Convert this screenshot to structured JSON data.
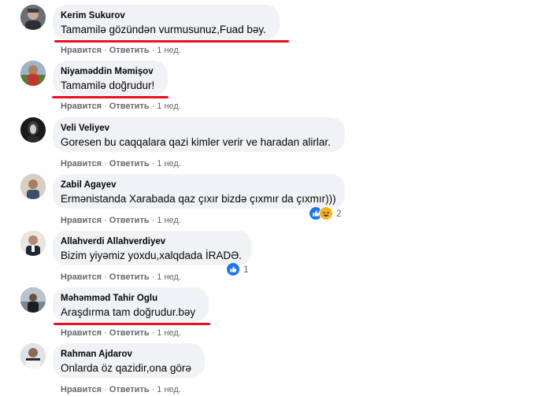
{
  "action_labels": {
    "like": "Нравится",
    "reply": "Ответить",
    "separator": "·"
  },
  "comments": [
    {
      "author": "Kerim Sukurov",
      "text": "Tamamilə gözündən vurmusunuz,Fuad bəy.",
      "time": "1 нед."
    },
    {
      "author": "Niyaməddin Məmişov",
      "text": "Tamamilə doğrudur!",
      "time": "1 нед."
    },
    {
      "author": "Veli Veliyev",
      "text": "Goresen bu caqqalara qazi kimler verir ve haradan alirlar.",
      "time": "1 нед."
    },
    {
      "author": "Zabil Agayev",
      "text": "Ermənistanda Xarabada qaz çıxır bizdə çıxmır da çıxmır)))",
      "time": "1 нед.",
      "reaction_count": "2",
      "reaction_icons": [
        "like-icon",
        "haha-icon"
      ]
    },
    {
      "author": "Allahverdi Allahverdiyev",
      "text": "Bizim yiyəmiz yoxdu,xalqdada İRADƏ.",
      "time": "1 нед.",
      "reaction_count": "1",
      "reaction_icons": [
        "like-icon"
      ]
    },
    {
      "author": "Məhəmməd Tahir Oglu",
      "text": "Araşdırma tam doğrudur.bəy",
      "time": "1 нед."
    },
    {
      "author": "Rahman Ajdarov",
      "text": "Onlarda öz qazidir,ona görə",
      "time": "1 нед."
    }
  ],
  "colors": {
    "bubble": "#f0f2f5",
    "meta": "#65676b",
    "highlight_underline": "#e8101f",
    "like": "#1877f2",
    "haha": "#f7b125"
  }
}
